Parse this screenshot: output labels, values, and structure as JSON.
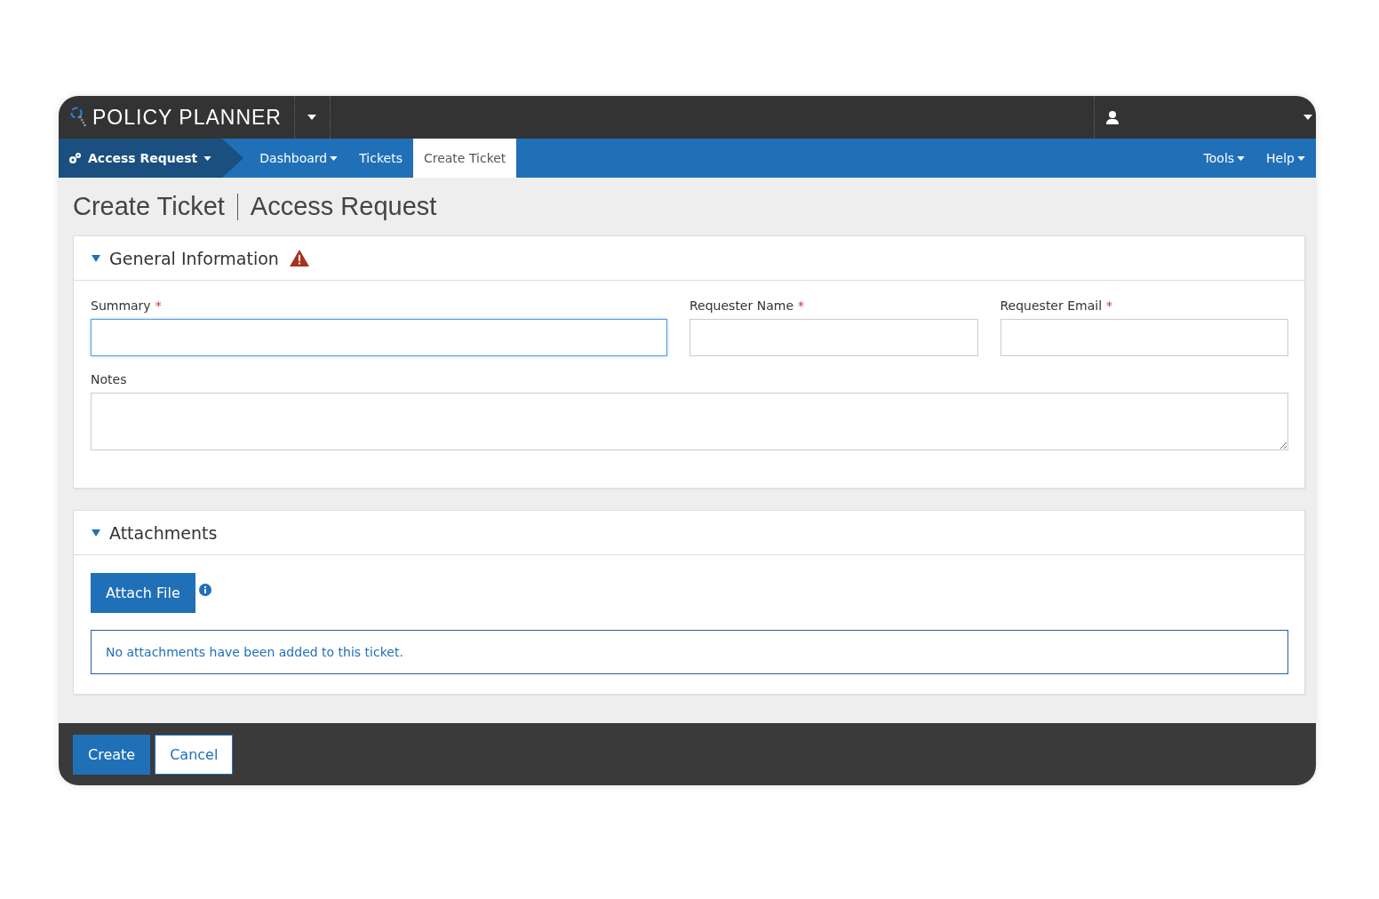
{
  "top_bar": {
    "brand": "POLICY PLANNER"
  },
  "nav": {
    "module": {
      "label": "Access Request",
      "caret": true
    },
    "tabs": [
      {
        "label": "Dashboard",
        "caret": true,
        "selected": false
      },
      {
        "label": "Tickets",
        "caret": false,
        "selected": false
      },
      {
        "label": "Create Ticket",
        "caret": false,
        "selected": true
      }
    ],
    "right_menus": [
      {
        "label": "Tools",
        "caret": true
      },
      {
        "label": "Help",
        "caret": true
      }
    ]
  },
  "page_title": {
    "main": "Create Ticket",
    "sub": "Access Request"
  },
  "sections": [
    {
      "title": "General Information",
      "expanded": true,
      "warning": true,
      "required_marker": "*",
      "rows": [
        [
          {
            "label": "Summary",
            "kind": "input",
            "required": true,
            "focused": true
          },
          {
            "label": "Requester Name",
            "kind": "input",
            "required": true,
            "focused": false
          },
          {
            "label": "Requester Email",
            "kind": "input",
            "required": true,
            "focused": false
          }
        ],
        [
          {
            "label": "Notes",
            "kind": "textarea",
            "required": false,
            "focused": false
          }
        ]
      ]
    },
    {
      "title": "Attachments",
      "expanded": true,
      "warning": false,
      "attach_button": "Attach File",
      "empty_message": "No attachments have been added to this ticket."
    }
  ],
  "footer": {
    "buttons": [
      {
        "label": "Create",
        "kind": "primary"
      },
      {
        "label": "Cancel",
        "kind": "secondary"
      }
    ]
  }
}
